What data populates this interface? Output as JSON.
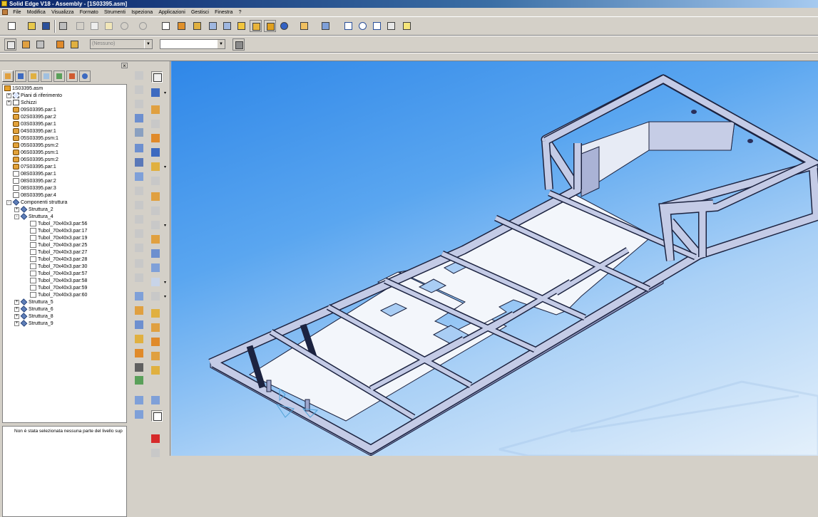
{
  "window": {
    "title": "Solid Edge V18 - Assembly - [1S03395.asm]"
  },
  "menubar": {
    "items": [
      "File",
      "Modifica",
      "Visualizza",
      "Formato",
      "Strumenti",
      "Ispeziona",
      "Applicazioni",
      "Gestisci",
      "Finestra",
      "?"
    ]
  },
  "toolbar": {
    "style_combo_value": "(Nessuno)",
    "second_combo_value": ""
  },
  "tree": {
    "nodes": [
      {
        "label": "1S03395.asm",
        "level": 0,
        "icon": "assembly-icon",
        "expander": ""
      },
      {
        "label": "Piani di riferimento",
        "level": 1,
        "icon": "plane-icon",
        "expander": "+"
      },
      {
        "label": "Schizzi",
        "level": 1,
        "icon": "sketch-icon",
        "expander": "+"
      },
      {
        "label": "09S03395.par:1",
        "level": 1,
        "icon": "part-icon",
        "expander": ""
      },
      {
        "label": "02S03395.par:2",
        "level": 1,
        "icon": "part-icon",
        "expander": ""
      },
      {
        "label": "03S03395.par:1",
        "level": 1,
        "icon": "part-icon",
        "expander": ""
      },
      {
        "label": "04S03395.par:1",
        "level": 1,
        "icon": "part-icon",
        "expander": ""
      },
      {
        "label": "05S03395.psm:1",
        "level": 1,
        "icon": "part-icon",
        "expander": ""
      },
      {
        "label": "05S03395.psm:2",
        "level": 1,
        "icon": "part-icon",
        "expander": ""
      },
      {
        "label": "06S03395.psm:1",
        "level": 1,
        "icon": "part-icon",
        "expander": ""
      },
      {
        "label": "06S03395.psm:2",
        "level": 1,
        "icon": "part-icon",
        "expander": ""
      },
      {
        "label": "07S03395.par:1",
        "level": 1,
        "icon": "part-icon",
        "expander": ""
      },
      {
        "label": "08S03395.par:1",
        "level": 1,
        "icon": "part-outline-icon",
        "expander": ""
      },
      {
        "label": "08S03395.par:2",
        "level": 1,
        "icon": "part-outline-icon",
        "expander": ""
      },
      {
        "label": "08S03395.par:3",
        "level": 1,
        "icon": "part-outline-icon",
        "expander": ""
      },
      {
        "label": "08S03395.par:4",
        "level": 1,
        "icon": "part-outline-icon",
        "expander": ""
      },
      {
        "label": "Componenti struttura",
        "level": 1,
        "icon": "structure-icon",
        "expander": "-"
      },
      {
        "label": "Struttura_2",
        "level": 2,
        "icon": "structure-icon",
        "expander": "+"
      },
      {
        "label": "Struttura_4",
        "level": 2,
        "icon": "structure-icon",
        "expander": "-"
      },
      {
        "label": "Tubol_70x40x3.par:56",
        "level": 3,
        "icon": "tube-icon",
        "expander": ""
      },
      {
        "label": "Tubol_70x40x3.par:17",
        "level": 3,
        "icon": "tube-icon",
        "expander": ""
      },
      {
        "label": "Tubol_70x40x3.par:19",
        "level": 3,
        "icon": "tube-icon",
        "expander": ""
      },
      {
        "label": "Tubol_70x40x3.par:25",
        "level": 3,
        "icon": "tube-icon",
        "expander": ""
      },
      {
        "label": "Tubol_70x40x3.par:27",
        "level": 3,
        "icon": "tube-icon",
        "expander": ""
      },
      {
        "label": "Tubol_70x40x3.par:28",
        "level": 3,
        "icon": "tube-icon",
        "expander": ""
      },
      {
        "label": "Tubol_70x40x3.par:30",
        "level": 3,
        "icon": "tube-icon",
        "expander": ""
      },
      {
        "label": "Tubol_70x40x3.par:57",
        "level": 3,
        "icon": "tube-icon",
        "expander": ""
      },
      {
        "label": "Tubol_70x40x3.par:58",
        "level": 3,
        "icon": "tube-icon",
        "expander": ""
      },
      {
        "label": "Tubol_70x40x3.par:59",
        "level": 3,
        "icon": "tube-icon",
        "expander": ""
      },
      {
        "label": "Tubol_70x40x3.par:60",
        "level": 3,
        "icon": "tube-icon",
        "expander": ""
      },
      {
        "label": "Struttura_5",
        "level": 2,
        "icon": "structure-icon",
        "expander": "+"
      },
      {
        "label": "Struttura_6",
        "level": 2,
        "icon": "structure-icon",
        "expander": "+"
      },
      {
        "label": "Struttura_8",
        "level": 2,
        "icon": "structure-icon",
        "expander": "+"
      },
      {
        "label": "Struttura_9",
        "level": 2,
        "icon": "structure-icon",
        "expander": "+"
      }
    ]
  },
  "status_panel": {
    "message": "Non è stata selezionata nessuna parte del livello sup"
  },
  "viewport": {
    "background_top": "#2f87e8",
    "background_bottom": "#e4f0fb",
    "frame_color": "#c4cbe6",
    "frame_edge": "#1c2340",
    "panel_color": "#f3f6fb"
  }
}
